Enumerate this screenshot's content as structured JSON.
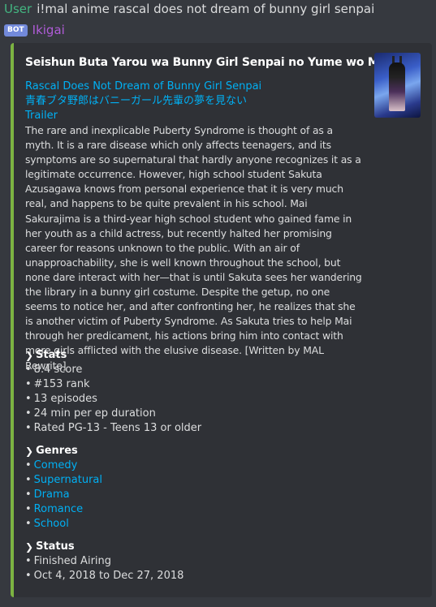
{
  "message": {
    "username": "User",
    "command": "i!mal anime rascal does not dream of bunny girl senpai"
  },
  "bot": {
    "tag": "BOT",
    "name": "Ikigai"
  },
  "embed": {
    "accent_color": "#7cb342",
    "title": "Seishun Buta Yarou wa Bunny Girl Senpai no Yume wo Minai",
    "english_title": "Rascal Does Not Dream of Bunny Girl Senpai",
    "japanese_title": "青春ブタ野郎はバニーガール先輩の夢を見ない",
    "trailer_label": "Trailer",
    "synopsis": "The rare and inexplicable Puberty Syndrome is thought of as a myth. It is a rare disease which only affects teenagers, and its symptoms are so supernatural that hardly anyone recognizes it as a legitimate occurrence. However, high school student Sakuta Azusagawa knows from personal experience that it is very much real, and happens to be quite prevalent in his school. Mai Sakurajima is a third-year high school student who gained fame in her youth as a child actress, but recently halted her promising career for reasons unknown to the public. With an air of unapproachability, she is well known throughout the school, but none dare interact with her—that is until Sakuta sees her wandering the library in a bunny girl costume. Despite the getup, no one seems to notice her, and after confronting her, he realizes that she is another victim of Puberty Syndrome. As Sakuta tries to help Mai through her predicament, his actions bring him into contact with more girls afflicted with the elusive disease. [Written by MAL Rewrite]",
    "stats": {
      "title": "Stats",
      "items": [
        "8.4 score",
        "#153 rank",
        "13 episodes",
        "24 min per ep duration",
        "Rated PG-13 - Teens 13 or older"
      ]
    },
    "genres": {
      "title": "Genres",
      "items": [
        "Comedy",
        "Supernatural",
        "Drama",
        "Romance",
        "School"
      ]
    },
    "status": {
      "title": "Status",
      "items": [
        "Finished Airing",
        "Oct 4, 2018 to Dec 27, 2018"
      ]
    }
  }
}
